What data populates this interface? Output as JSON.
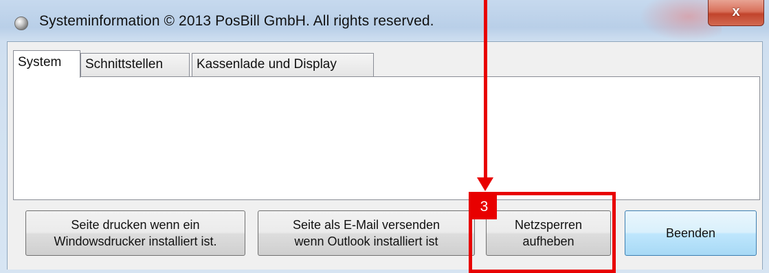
{
  "window": {
    "title": "Systeminformation © 2013 PosBill GmbH. All rights reserved.",
    "close_label": "x"
  },
  "tabs": [
    {
      "label": "System",
      "active": true
    },
    {
      "label": "Schnittstellen",
      "active": false
    },
    {
      "label": "Kassenlade und Display",
      "active": false
    }
  ],
  "buttons": {
    "print": "Seite drucken wenn ein\nWindowsdrucker installiert ist.",
    "email": "Seite als E-Mail versenden\nwenn Outlook installiert ist",
    "unlock": "Netzsperren\naufheben",
    "exit": "Beenden"
  },
  "annotation": {
    "badge": "3",
    "color": "#e80000"
  }
}
